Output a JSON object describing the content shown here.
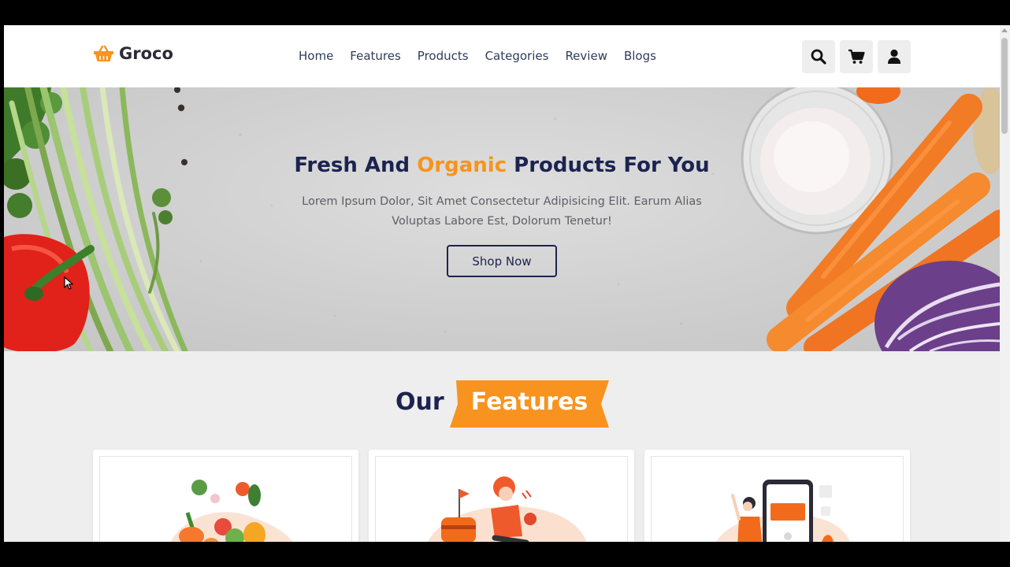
{
  "brand": {
    "name": "Groco",
    "icon": "basket-icon",
    "accent_color": "#f7931e",
    "dark_color": "#1c2350"
  },
  "nav": {
    "items": [
      {
        "label": "Home"
      },
      {
        "label": "Features"
      },
      {
        "label": "Products"
      },
      {
        "label": "Categories"
      },
      {
        "label": "Review"
      },
      {
        "label": "Blogs"
      }
    ]
  },
  "header_icons": [
    "search-icon",
    "cart-icon",
    "user-icon"
  ],
  "hero": {
    "title_part1": "Fresh And ",
    "title_accent": "Organic",
    "title_part2": " Products For You",
    "subtitle_line1": "Lorem Ipsum Dolor, Sit Amet Consectetur Adipisicing Elit. Earum Alias",
    "subtitle_line2": "Voluptas Labore Est, Dolorum Tenetur!",
    "button_label": "Shop Now"
  },
  "features": {
    "heading_plain": "Our",
    "heading_highlight": "Features",
    "cards": [
      {
        "illustration": "vegetables-illustration"
      },
      {
        "illustration": "delivery-illustration"
      },
      {
        "illustration": "mobile-order-illustration"
      }
    ]
  }
}
